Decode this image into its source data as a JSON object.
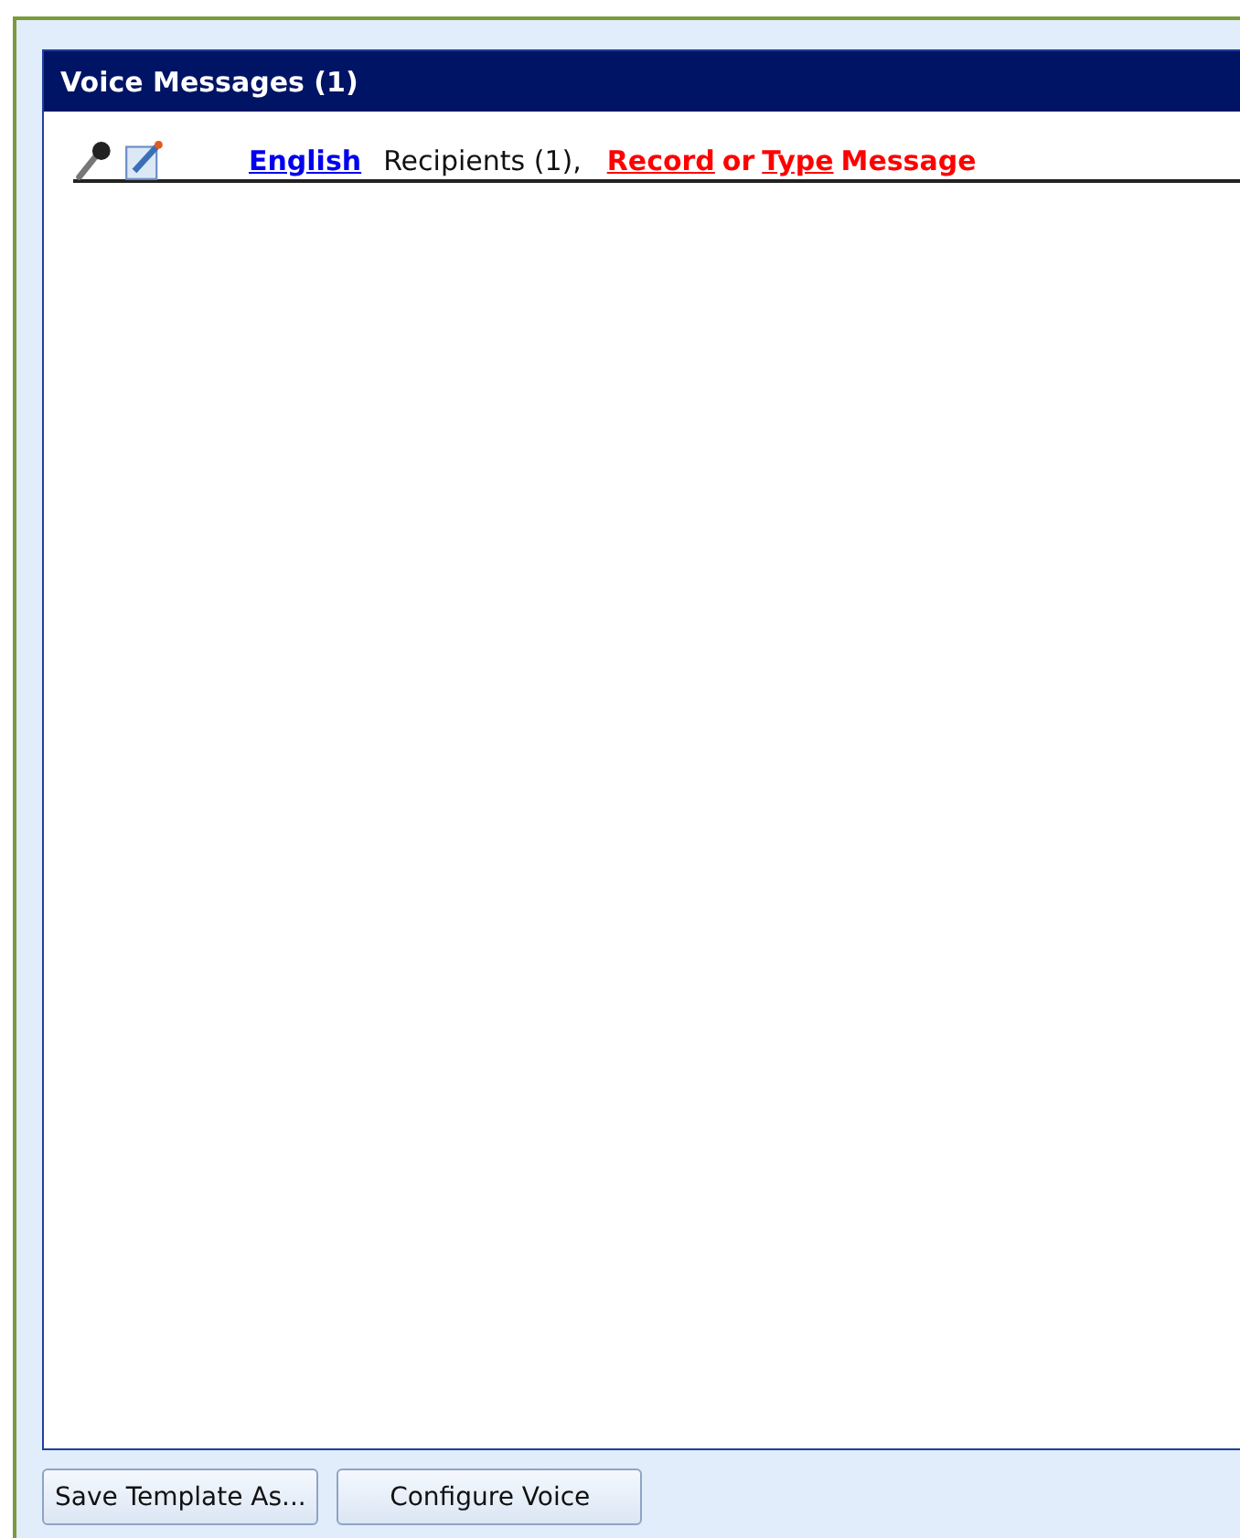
{
  "panel": {
    "title": "Voice Messages (1)"
  },
  "messages": [
    {
      "language": "English",
      "recipients": "Recipients (1),",
      "record": "Record",
      "joiner": "or",
      "type": "Type",
      "tail": "Message"
    }
  ],
  "buttons": [
    "Save Template As...",
    "Configure Voice"
  ]
}
